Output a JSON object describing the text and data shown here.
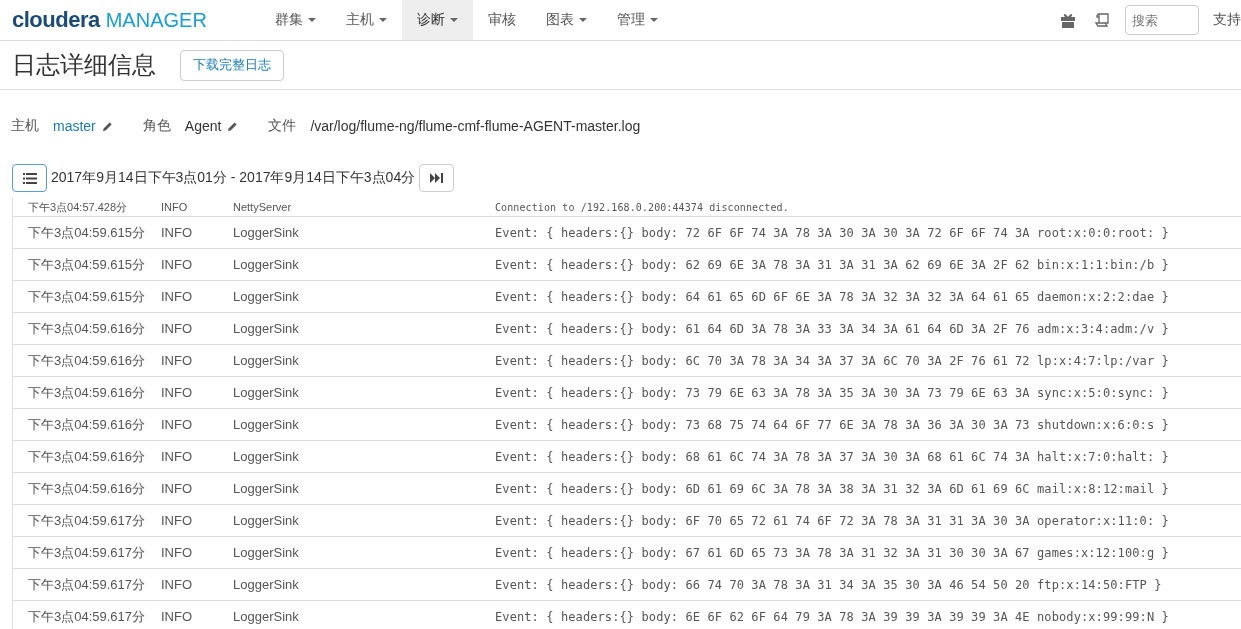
{
  "navbar": {
    "logo_brand": "cloudera",
    "logo_product": "MANAGER",
    "menus": [
      {
        "label": "群集",
        "dropdown": true,
        "selected": false
      },
      {
        "label": "主机",
        "dropdown": true,
        "selected": false
      },
      {
        "label": "诊断",
        "dropdown": true,
        "selected": true
      },
      {
        "label": "审核",
        "dropdown": false,
        "selected": false
      },
      {
        "label": "图表",
        "dropdown": true,
        "selected": false
      },
      {
        "label": "管理",
        "dropdown": true,
        "selected": false
      }
    ],
    "search": {
      "placeholder": "搜索"
    },
    "support": "支持"
  },
  "page": {
    "title": "日志详细信息",
    "download_button": "下载完整日志"
  },
  "details": [
    {
      "label": "主机",
      "value": "master",
      "kind": "link",
      "editable": true
    },
    {
      "label": "角色",
      "value": "Agent",
      "kind": "text",
      "editable": true
    },
    {
      "label": "文件",
      "value": "/var/log/flume-ng/flume-cmf-flume-AGENT-master.log",
      "kind": "text",
      "editable": false
    }
  ],
  "range": "2017年9月14日下午3点01分 - 2017年9月14日下午3点04分",
  "log_rows": [
    {
      "time": "下午3点04:57.428分",
      "level": "INFO",
      "source": "NettyServer",
      "message": "Connection to /192.168.0.200:44374 disconnected."
    },
    {
      "time": "下午3点04:59.615分",
      "level": "INFO",
      "source": "LoggerSink",
      "message": "Event: { headers:{} body: 72 6F 6F 74 3A 78 3A 30 3A 30 3A 72 6F 6F 74 3A root:x:0:0:root: }"
    },
    {
      "time": "下午3点04:59.615分",
      "level": "INFO",
      "source": "LoggerSink",
      "message": "Event: { headers:{} body: 62 69 6E 3A 78 3A 31 3A 31 3A 62 69 6E 3A 2F 62 bin:x:1:1:bin:/b }"
    },
    {
      "time": "下午3点04:59.615分",
      "level": "INFO",
      "source": "LoggerSink",
      "message": "Event: { headers:{} body: 64 61 65 6D 6F 6E 3A 78 3A 32 3A 32 3A 64 61 65 daemon:x:2:2:dae }"
    },
    {
      "time": "下午3点04:59.616分",
      "level": "INFO",
      "source": "LoggerSink",
      "message": "Event: { headers:{} body: 61 64 6D 3A 78 3A 33 3A 34 3A 61 64 6D 3A 2F 76 adm:x:3:4:adm:/v }"
    },
    {
      "time": "下午3点04:59.616分",
      "level": "INFO",
      "source": "LoggerSink",
      "message": "Event: { headers:{} body: 6C 70 3A 78 3A 34 3A 37 3A 6C 70 3A 2F 76 61 72 lp:x:4:7:lp:/var }"
    },
    {
      "time": "下午3点04:59.616分",
      "level": "INFO",
      "source": "LoggerSink",
      "message": "Event: { headers:{} body: 73 79 6E 63 3A 78 3A 35 3A 30 3A 73 79 6E 63 3A sync:x:5:0:sync: }"
    },
    {
      "time": "下午3点04:59.616分",
      "level": "INFO",
      "source": "LoggerSink",
      "message": "Event: { headers:{} body: 73 68 75 74 64 6F 77 6E 3A 78 3A 36 3A 30 3A 73 shutdown:x:6:0:s }"
    },
    {
      "time": "下午3点04:59.616分",
      "level": "INFO",
      "source": "LoggerSink",
      "message": "Event: { headers:{} body: 68 61 6C 74 3A 78 3A 37 3A 30 3A 68 61 6C 74 3A halt:x:7:0:halt: }"
    },
    {
      "time": "下午3点04:59.616分",
      "level": "INFO",
      "source": "LoggerSink",
      "message": "Event: { headers:{} body: 6D 61 69 6C 3A 78 3A 38 3A 31 32 3A 6D 61 69 6C mail:x:8:12:mail }"
    },
    {
      "time": "下午3点04:59.617分",
      "level": "INFO",
      "source": "LoggerSink",
      "message": "Event: { headers:{} body: 6F 70 65 72 61 74 6F 72 3A 78 3A 31 31 3A 30 3A operator:x:11:0: }"
    },
    {
      "time": "下午3点04:59.617分",
      "level": "INFO",
      "source": "LoggerSink",
      "message": "Event: { headers:{} body: 67 61 6D 65 73 3A 78 3A 31 32 3A 31 30 30 3A 67 games:x:12:100:g }"
    },
    {
      "time": "下午3点04:59.617分",
      "level": "INFO",
      "source": "LoggerSink",
      "message": "Event: { headers:{} body: 66 74 70 3A 78 3A 31 34 3A 35 30 3A 46 54 50 20 ftp:x:14:50:FTP  }"
    },
    {
      "time": "下午3点04:59.617分",
      "level": "INFO",
      "source": "LoggerSink",
      "message": "Event: { headers:{} body: 6E 6F 62 6F 64 79 3A 78 3A 39 39 3A 39 39 3A 4E nobody:x:99:99:N }"
    }
  ]
}
